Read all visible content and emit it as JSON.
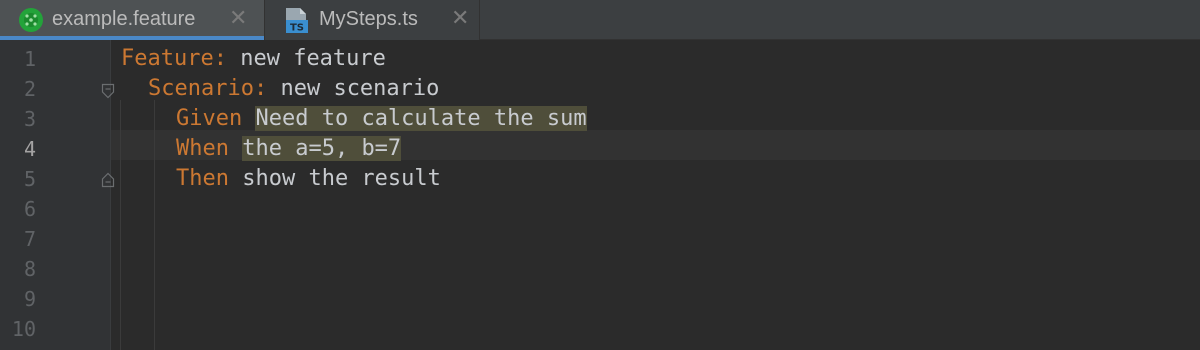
{
  "tabs": [
    {
      "label": "example.feature",
      "icon": "cucumber-icon",
      "active": true,
      "close": "✕"
    },
    {
      "label": "MySteps.ts",
      "icon": "typescript-file-icon",
      "active": false,
      "close": "✕",
      "icon_text": "TS"
    }
  ],
  "gutter": {
    "line_numbers": [
      "1",
      "2",
      "3",
      "4",
      "5",
      "6",
      "7",
      "8",
      "9",
      "10"
    ],
    "current_line": "4"
  },
  "code": {
    "line1": {
      "keyword": "Feature:",
      "text": " new feature"
    },
    "line2": {
      "keyword": "Scenario:",
      "text": " new scenario"
    },
    "line3": {
      "keyword": "Given",
      "text": "Need to calculate the sum"
    },
    "line4": {
      "keyword": "When",
      "text": "the a=5, b=7"
    },
    "line5": {
      "keyword": "Then",
      "text": " show the result"
    }
  },
  "colors": {
    "background": "#2b2b2b",
    "keyword": "#cc7832",
    "text": "#c8cbcf",
    "step_highlight": "#4f4e3a",
    "active_tab_underline": "#4a88c7"
  }
}
